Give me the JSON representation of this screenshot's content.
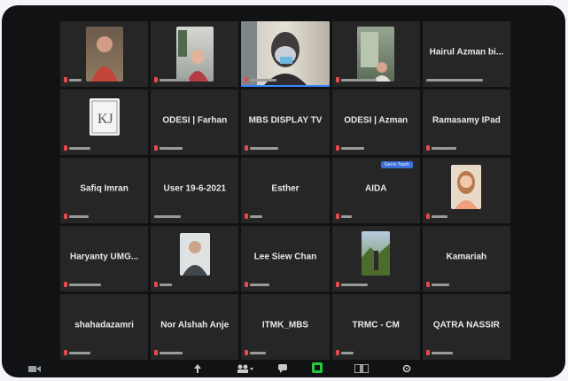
{
  "meeting": {
    "tiles": [
      {
        "name": "",
        "kind": "video-person-red"
      },
      {
        "name": "",
        "kind": "video-room"
      },
      {
        "name": "",
        "kind": "video-masked-speaker"
      },
      {
        "name": "",
        "kind": "video-side"
      },
      {
        "name": "Hairul Azman bi...",
        "kind": "name"
      },
      {
        "name": "",
        "kind": "logo-kj",
        "logo_text": "KJ"
      },
      {
        "name": "ODESI | Farhan",
        "kind": "name"
      },
      {
        "name": "MBS DISPLAY TV",
        "kind": "name"
      },
      {
        "name": "ODESI | Azman",
        "kind": "name"
      },
      {
        "name": "Ramasamy IPad",
        "kind": "name"
      },
      {
        "name": "Safiq Imran",
        "kind": "name"
      },
      {
        "name": "User 19-6-2021",
        "kind": "name"
      },
      {
        "name": "Esther",
        "kind": "name"
      },
      {
        "name": "AIDA",
        "kind": "name",
        "badge": "Get in Touch"
      },
      {
        "name": "",
        "kind": "photo-woman"
      },
      {
        "name": "Haryanty UMG...",
        "kind": "name"
      },
      {
        "name": "",
        "kind": "photo-man"
      },
      {
        "name": "Lee Siew Chan",
        "kind": "name"
      },
      {
        "name": "",
        "kind": "photo-outdoor"
      },
      {
        "name": "Kamariah",
        "kind": "name"
      },
      {
        "name": "shahadazamri",
        "kind": "name"
      },
      {
        "name": "Nor Alshah Anje",
        "kind": "name"
      },
      {
        "name": "ITMK_MBS",
        "kind": "name"
      },
      {
        "name": "TRMC - CM",
        "kind": "name"
      },
      {
        "name": "QATRA NASSIR",
        "kind": "name"
      }
    ]
  },
  "toolbar": {
    "icons": [
      "camera-icon",
      "share-icon",
      "participants-icon",
      "chat-icon",
      "record-icon",
      "view-icon",
      "settings-icon"
    ]
  },
  "colors": {
    "background": "#111214",
    "tile": "#262626",
    "mic_muted": "#e5484d",
    "record_green": "#23c840",
    "badge": "#3a6fd8"
  }
}
